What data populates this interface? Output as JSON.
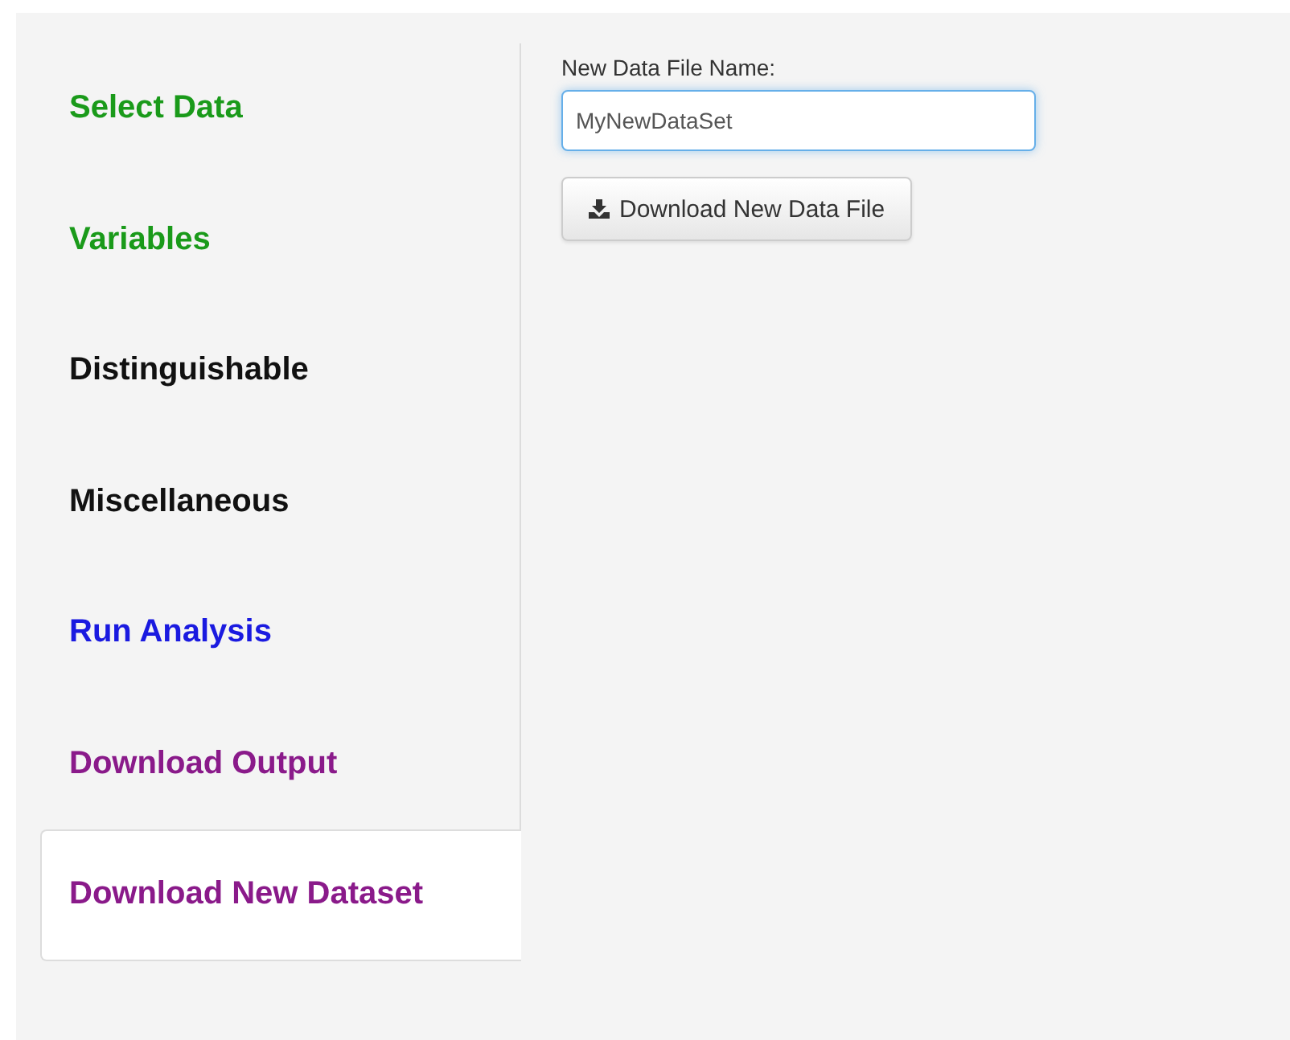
{
  "tabs": [
    {
      "label": "Select Data",
      "color": "#1a9a1a",
      "selected": false
    },
    {
      "label": "Variables",
      "color": "#1a9a1a",
      "selected": false
    },
    {
      "label": "Distinguishable",
      "color": "#111111",
      "selected": false
    },
    {
      "label": "Miscellaneous",
      "color": "#111111",
      "selected": false
    },
    {
      "label": "Run Analysis",
      "color": "#1a1ae0",
      "selected": false
    },
    {
      "label": "Download Output",
      "color": "#8a1a8a",
      "selected": false
    },
    {
      "label": "Download New Dataset",
      "color": "#8a1a8a",
      "selected": true
    }
  ],
  "form": {
    "label": "New Data File Name:",
    "value": "MyNewDataSet",
    "button": "Download New Data File"
  }
}
